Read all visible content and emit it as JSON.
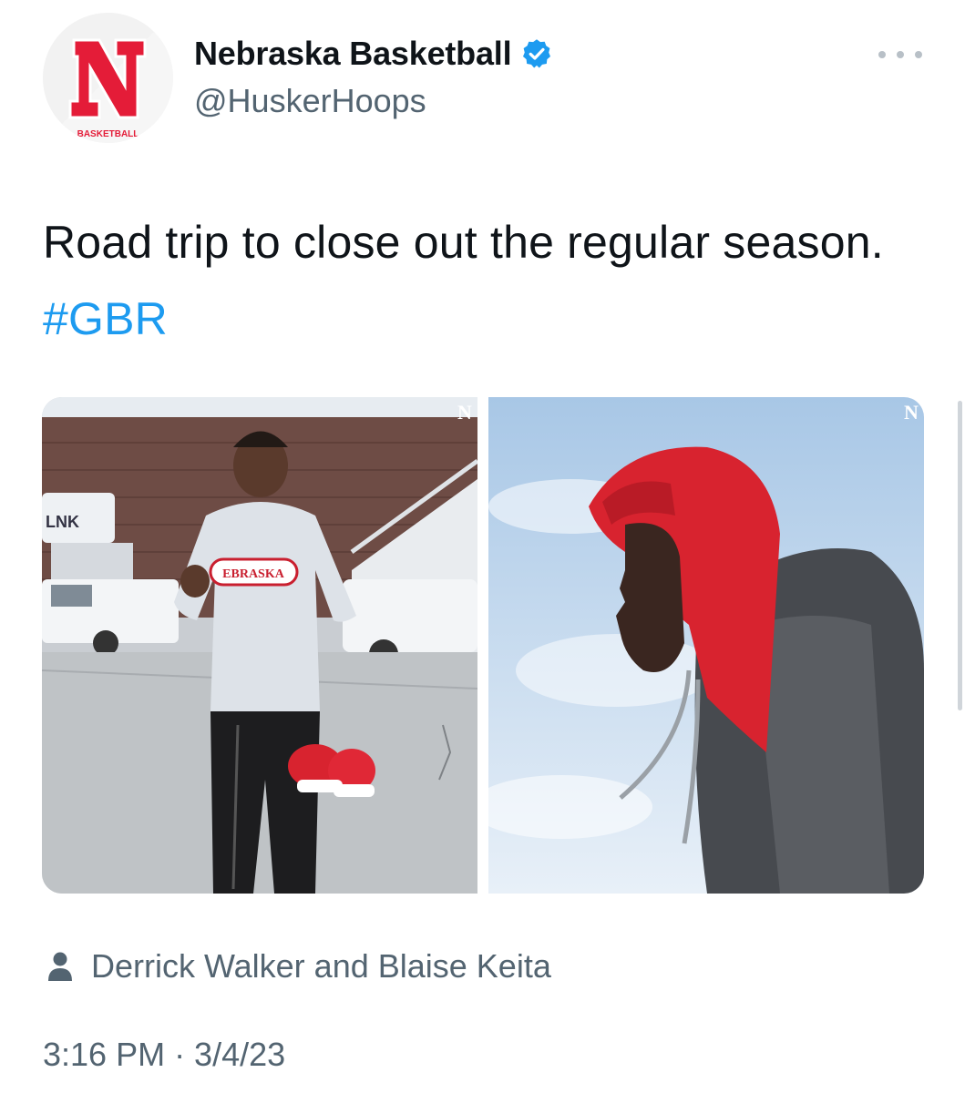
{
  "account": {
    "display_name": "Nebraska Basketball",
    "handle": "@HuskerHoops",
    "verified": true,
    "avatar_logo_letter": "N",
    "avatar_logo_caption": "BASKETBALL",
    "brand_color": "#e41c38"
  },
  "tweet": {
    "text": "Road trip to close out the regular season.",
    "hashtag": "#GBR",
    "hashtag_color": "#1d9bf0"
  },
  "media": {
    "photos": [
      {
        "icon": "photo-player-airport-icon"
      },
      {
        "icon": "photo-player-red-hood-icon"
      }
    ]
  },
  "tags": {
    "people_text": "Derrick Walker and Blaise Keita"
  },
  "meta": {
    "timestamp": "3:16 PM · 3/4/23"
  }
}
